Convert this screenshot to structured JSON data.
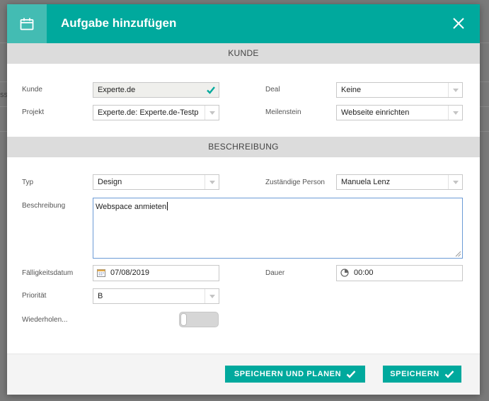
{
  "backdrop": {
    "fragment": "ss"
  },
  "dialog": {
    "title": "Aufgabe hinzufügen",
    "accent_color": "#00a99d"
  },
  "sections": {
    "kunde": "KUNDE",
    "beschreibung": "BESCHREIBUNG"
  },
  "kunde_section": {
    "kunde": {
      "label": "Kunde",
      "value": "Experte.de"
    },
    "projekt": {
      "label": "Projekt",
      "value": "Experte.de: Experte.de-Testp"
    },
    "deal": {
      "label": "Deal",
      "value": "Keine"
    },
    "meilenstein": {
      "label": "Meilenstein",
      "value": "Webseite einrichten"
    }
  },
  "beschreibung_section": {
    "typ": {
      "label": "Typ",
      "value": "Design"
    },
    "zustaendig": {
      "label": "Zuständige Person",
      "value": "Manuela Lenz"
    },
    "beschreibung": {
      "label": "Beschreibung",
      "value": "Webspace anmieten"
    },
    "faelligkeit": {
      "label": "Fälligkeitsdatum",
      "value": "07/08/2019"
    },
    "dauer": {
      "label": "Dauer",
      "value": "00:00"
    },
    "prioritaet": {
      "label": "Priorität",
      "value": "B"
    },
    "wiederholen": {
      "label": "Wiederholen...",
      "enabled": false
    }
  },
  "footer": {
    "save_plan_label": "SPEICHERN UND PLANEN",
    "save_label": "SPEICHERN"
  },
  "icons": {
    "header": "calendar-icon",
    "close": "close-icon",
    "check": "check-icon",
    "date": "calendar-small-icon",
    "duration": "clock-icon"
  }
}
